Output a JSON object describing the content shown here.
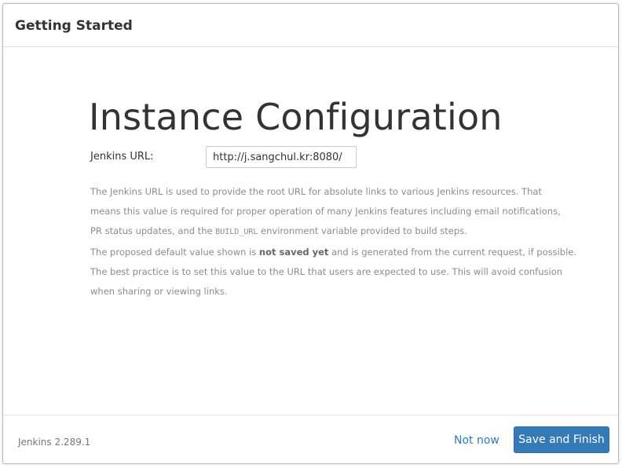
{
  "header": {
    "title": "Getting Started"
  },
  "main": {
    "title": "Instance Configuration",
    "url_label": "Jenkins URL:",
    "url_value": "http://j.sangchul.kr:8080/",
    "help": {
      "p1_line1": "The Jenkins URL is used to provide the root URL for absolute links to various Jenkins resources. That",
      "p1_line2": "means this value is required for proper operation of many Jenkins features including email notifications,",
      "p1_line3_a": "PR status updates, and the ",
      "p1_line3_code": "BUILD_URL",
      "p1_line3_b": " environment variable provided to build steps.",
      "p2_a": "The proposed default value shown is ",
      "p2_bold": "not saved yet",
      "p2_b": " and is generated from the current request, if possible.",
      "p2_line2": "The best practice is to set this value to the URL that users are expected to use. This will avoid confusion",
      "p2_line3": "when sharing or viewing links."
    }
  },
  "footer": {
    "version": "Jenkins 2.289.1",
    "not_now_label": "Not now",
    "save_label": "Save and Finish"
  },
  "colors": {
    "primary": "#337ab7",
    "link": "#337ab7",
    "help_text": "#8c8c8c",
    "title_text": "#333333"
  }
}
